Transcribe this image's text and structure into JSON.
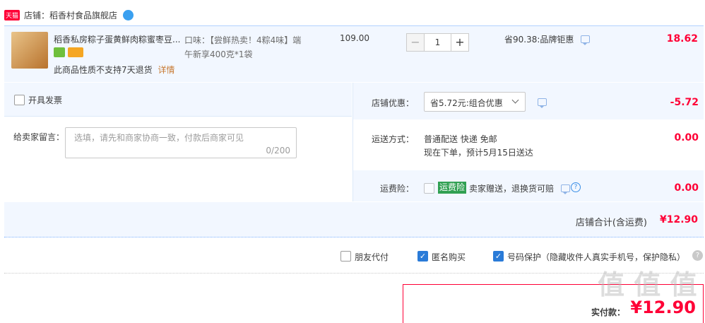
{
  "shop": {
    "badge": "天猫",
    "label": "店铺：",
    "name": "稻香村食品旗舰店",
    "wangwang": "wangwang-icon"
  },
  "item": {
    "title": "稻香私房粽子蛋黄鲜肉粽蜜枣豆...",
    "sku": "口味：【尝鲜热卖！4粽4味】端午新享400克*1袋",
    "price": "109.00",
    "qty": "1",
    "minus": "−",
    "plus": "+",
    "promo": "省90.38:品牌钜惠",
    "subtotal": "18.62",
    "notice": "此商品性质不支持7天退货",
    "detail_link": "详情"
  },
  "invoice": {
    "label": "开具发票"
  },
  "message": {
    "label": "给卖家留言：",
    "placeholder": "选填，请先和商家协商一致，付款后商家可见",
    "count": "0/200"
  },
  "shop_discount": {
    "label": "店铺优惠：",
    "value": "省5.72元:组合优惠",
    "amount": "-5.72"
  },
  "shipping": {
    "label": "运送方式：",
    "line1": "普通配送 快递 免邮",
    "line2": "现在下单，预计5月15日送达",
    "amount": "0.00"
  },
  "insurance": {
    "label": "运费险：",
    "tag": "运费险",
    "text": "卖家赠送，退换货可赔",
    "amount": "0.00"
  },
  "shop_total": {
    "label": "店铺合计(含运费)",
    "amount": "¥12.90"
  },
  "options": {
    "friend_pay": "朋友代付",
    "anonymous": "匿名购买",
    "number_protect": "号码保护（隐藏收件人真实手机号，保护隐私）"
  },
  "pay": {
    "label": "实付款：",
    "amount": "¥12.90"
  },
  "watermark": "值 值 值",
  "colors": {
    "accent_red": "#ff0036",
    "brand_blue": "#2a7bd8",
    "panel_bg": "#f2f7ff"
  }
}
